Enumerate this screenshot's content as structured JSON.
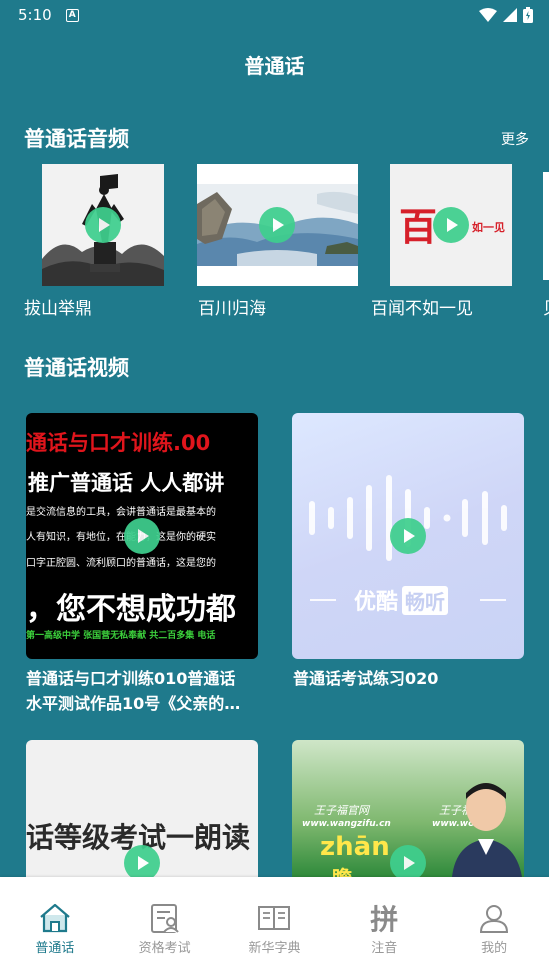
{
  "status": {
    "time": "5:10",
    "a_icon": "A"
  },
  "header": {
    "title": "普通话"
  },
  "audio_section": {
    "title": "普通话音频",
    "more": "更多",
    "items": [
      {
        "label": "拔山举鼎"
      },
      {
        "label": "百川归海"
      },
      {
        "label": "百闻不如一见"
      },
      {
        "label": "贝"
      }
    ],
    "thumb3_big_char": "百",
    "thumb3_small_text": "如一见"
  },
  "video_section": {
    "title": "普通话视频",
    "cards": [
      {
        "title_line1": "普通话与口才训练010普通话",
        "title_line2": "水平测试作品10号《父亲的…",
        "thumb_text": {
          "line1": "通话与口才训练.00",
          "line2": "推广普通话  人人都讲",
          "line3": "是交流信息的工具，会讲普通话是最基本的",
          "line4": "人有知识，有地位，在能力，这是你的硬实",
          "line5": "口字正腔圆、流利顾口的普通话，这是您的",
          "line6": "，您不想成功都",
          "line7": "第一高级中学  张国营无私奉献  共二百多集  电话"
        }
      },
      {
        "title_line1": "普通话考试练习020",
        "thumb_text": {
          "brand": "优酷",
          "tag": "畅听"
        }
      },
      {
        "thumb_text": {
          "line1": "话等级考试一朗读"
        }
      },
      {
        "thumb_text": {
          "site": "王子福官网",
          "url": "www.wangzifu.cn",
          "site2": "王子福",
          "url2": "www.wo",
          "pinyin": "zhān",
          "char_partial": "瞻"
        }
      }
    ]
  },
  "tabbar": {
    "tabs": [
      {
        "label": "普通话",
        "icon": "home-icon",
        "active": true
      },
      {
        "label": "资格考试",
        "icon": "exam-icon",
        "active": false
      },
      {
        "label": "新华字典",
        "icon": "book-icon",
        "active": false
      },
      {
        "label": "注音",
        "icon": "pinyin-icon",
        "glyph": "拼",
        "active": false
      },
      {
        "label": "我的",
        "icon": "user-icon",
        "active": false
      }
    ]
  },
  "colors": {
    "background": "#1f7a8c",
    "play": "#3fcf8e",
    "tab_active": "#1f7a8c",
    "tab_inactive": "#999999"
  }
}
